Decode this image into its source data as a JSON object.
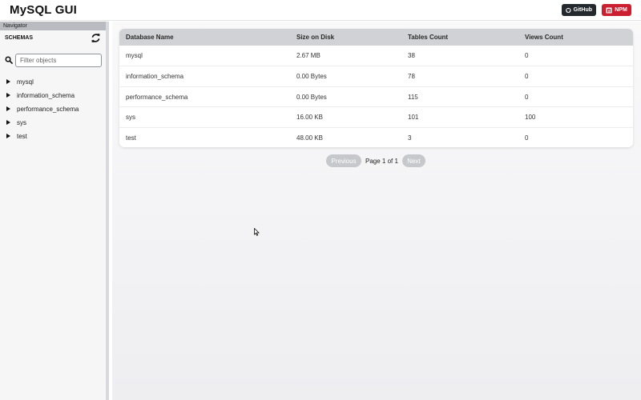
{
  "header": {
    "title": "MySQL GUI",
    "github_label": "GitHub",
    "npm_label": "NPM",
    "github_color": "#24292e",
    "npm_color": "#cb1f2f",
    "github_icon": "github-icon",
    "npm_icon": "npm-icon"
  },
  "sidebar": {
    "navigator_label": "Navigator",
    "schemas_label": "SCHEMAS",
    "refresh_icon": "refresh-icon",
    "search_icon": "search-icon",
    "filter_placeholder": "Filter objects",
    "filter_value": "",
    "items": [
      {
        "label": "mysql"
      },
      {
        "label": "information_schema"
      },
      {
        "label": "performance_schema"
      },
      {
        "label": "sys"
      },
      {
        "label": "test"
      }
    ]
  },
  "table": {
    "columns": [
      "Database Name",
      "Size on Disk",
      "Tables Count",
      "Views Count"
    ],
    "rows": [
      [
        "mysql",
        "2.67 MB",
        "38",
        "0"
      ],
      [
        "information_schema",
        "0.00 Bytes",
        "78",
        "0"
      ],
      [
        "performance_schema",
        "0.00 Bytes",
        "115",
        "0"
      ],
      [
        "sys",
        "16.00 KB",
        "101",
        "100"
      ],
      [
        "test",
        "48.00 KB",
        "3",
        "0"
      ]
    ],
    "header_color": "#d0d2d6"
  },
  "pagination": {
    "previous_label": "Previous",
    "page_text": "Page 1 of 1",
    "next_label": "Next"
  }
}
